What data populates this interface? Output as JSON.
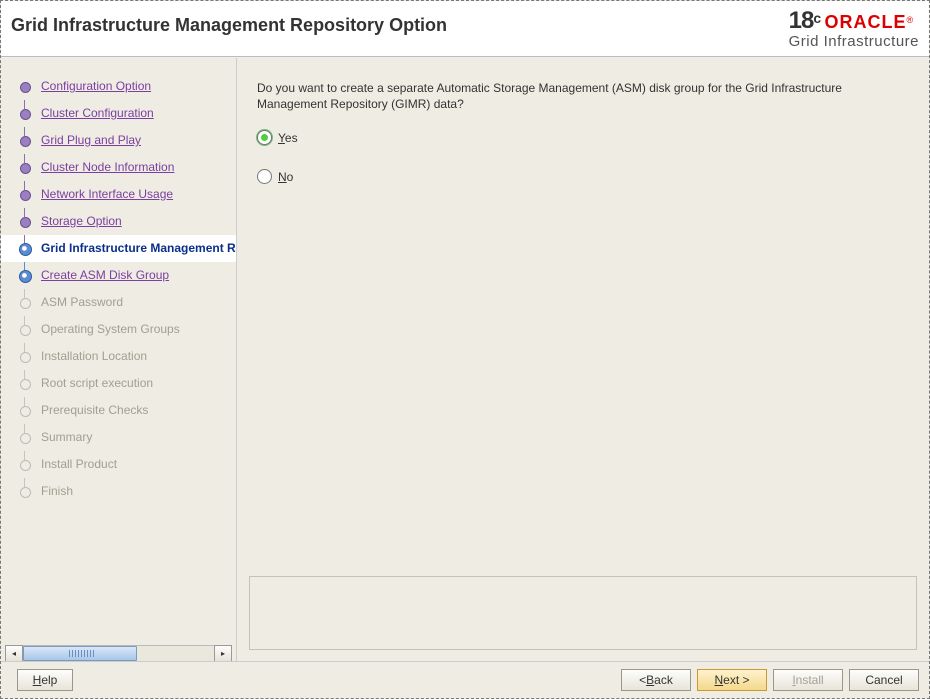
{
  "header": {
    "title": "Grid Infrastructure Management Repository Option",
    "brand_version_major": "18",
    "brand_version_sup": "c",
    "brand_name": "ORACLE",
    "brand_reg": "®",
    "brand_sub": "Grid Infrastructure"
  },
  "sidebar": {
    "steps": [
      {
        "label": "Configuration Option",
        "state": "done"
      },
      {
        "label": "Cluster Configuration",
        "state": "done"
      },
      {
        "label": "Grid Plug and Play",
        "state": "done"
      },
      {
        "label": "Cluster Node Information",
        "state": "done"
      },
      {
        "label": "Network Interface Usage",
        "state": "done"
      },
      {
        "label": "Storage Option",
        "state": "done"
      },
      {
        "label": "Grid Infrastructure Management Repository Option",
        "state": "current"
      },
      {
        "label": "Create ASM Disk Group",
        "state": "next"
      },
      {
        "label": "ASM Password",
        "state": "future"
      },
      {
        "label": "Operating System Groups",
        "state": "future"
      },
      {
        "label": "Installation Location",
        "state": "future"
      },
      {
        "label": "Root script execution",
        "state": "future"
      },
      {
        "label": "Prerequisite Checks",
        "state": "future"
      },
      {
        "label": "Summary",
        "state": "future"
      },
      {
        "label": "Install Product",
        "state": "future"
      },
      {
        "label": "Finish",
        "state": "future"
      }
    ]
  },
  "main": {
    "prompt": "Do you want to create a separate Automatic Storage Management (ASM) disk group for the Grid Infrastructure Management Repository (GIMR) data?",
    "options": [
      {
        "mnemonic": "Y",
        "rest": "es",
        "selected": true
      },
      {
        "mnemonic": "N",
        "rest": "o",
        "selected": false
      }
    ]
  },
  "footer": {
    "help": "Help",
    "back_mn": "B",
    "back_rest": "ack",
    "next_mn": "N",
    "next_rest": "ext >",
    "install_mn": "I",
    "install_rest": "nstall",
    "cancel": "Cancel"
  }
}
